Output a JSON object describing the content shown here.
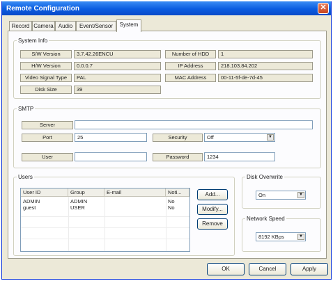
{
  "window": {
    "title": "Remote Configuration",
    "close_glyph": "✕"
  },
  "tabs": [
    "Record",
    "Camera",
    "Audio",
    "Event/Sensor",
    "System"
  ],
  "active_tab": "System",
  "system_info": {
    "legend": "System Info",
    "sw_version_label": "S/W Version",
    "sw_version": "3.7.42.26ENCU",
    "hw_version_label": "H/W Version",
    "hw_version": "0.0.0.7",
    "video_signal_label": "Video Signal Type",
    "video_signal": "PAL",
    "disk_size_label": "Disk Size",
    "disk_size": "39",
    "hdd_count_label": "Number of HDD",
    "hdd_count": "1",
    "ip_label": "IP Address",
    "ip": "218.103.84.202",
    "mac_label": "MAC Address",
    "mac": "00-11-5f-de-7d-45"
  },
  "smtp": {
    "legend": "SMTP",
    "server_label": "Server",
    "server": "",
    "port_label": "Port",
    "port": "25",
    "security_label": "Security",
    "security": "Off",
    "user_label": "User",
    "user": "",
    "password_label": "Password",
    "password": "1234"
  },
  "users": {
    "legend": "Users",
    "columns": [
      "User ID",
      "Group",
      "E-mail",
      "Noti..."
    ],
    "rows": [
      {
        "id": "ADMIN",
        "group": "ADMIN",
        "email": "",
        "noti": "No"
      },
      {
        "id": "guest",
        "group": "USER",
        "email": "",
        "noti": "No"
      }
    ],
    "add_label": "Add...",
    "modify_label": "Modify...",
    "remove_label": "Remove"
  },
  "disk_overwrite": {
    "legend": "Disk Overwrite",
    "value": "On"
  },
  "network_speed": {
    "legend": "Network Speed",
    "value": "8192 KBps"
  },
  "footer": {
    "ok_label": "OK",
    "cancel_label": "Cancel",
    "apply_label": "Apply"
  }
}
